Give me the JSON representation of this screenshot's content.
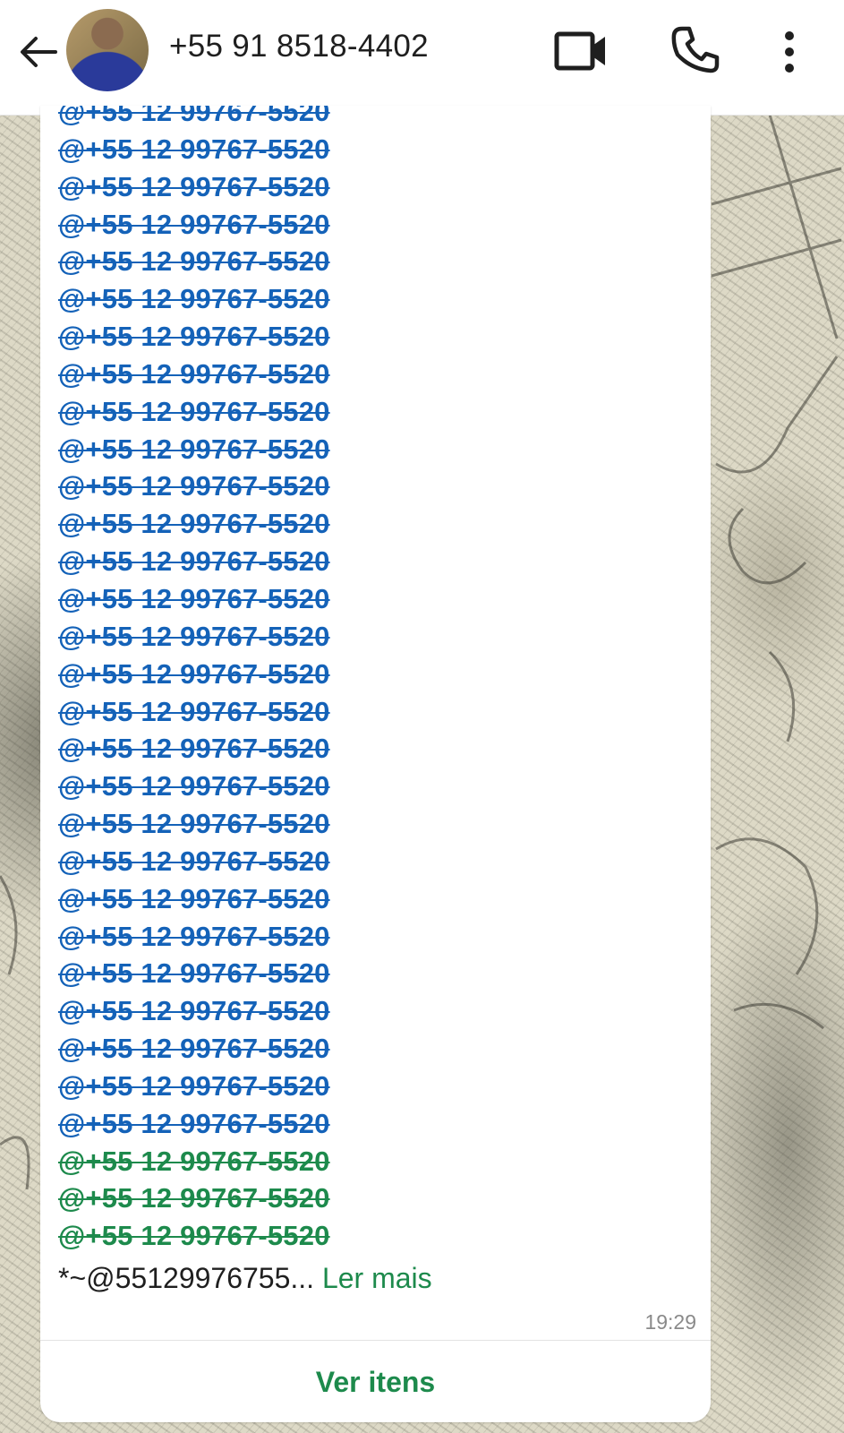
{
  "header": {
    "contact_name": "+55 91 8518-4402",
    "back_icon": "arrow-left-icon",
    "video_icon": "video-camera-icon",
    "call_icon": "phone-icon",
    "more_icon": "more-vertical-icon"
  },
  "message": {
    "mentions": [
      {
        "text": "@+55 12 99767-5520",
        "color": "blue"
      },
      {
        "text": "@+55 12 99767-5520",
        "color": "blue"
      },
      {
        "text": "@+55 12 99767-5520",
        "color": "blue"
      },
      {
        "text": "@+55 12 99767-5520",
        "color": "blue"
      },
      {
        "text": "@+55 12 99767-5520",
        "color": "blue"
      },
      {
        "text": "@+55 12 99767-5520",
        "color": "blue"
      },
      {
        "text": "@+55 12 99767-5520",
        "color": "blue"
      },
      {
        "text": "@+55 12 99767-5520",
        "color": "blue"
      },
      {
        "text": "@+55 12 99767-5520",
        "color": "blue"
      },
      {
        "text": "@+55 12 99767-5520",
        "color": "blue"
      },
      {
        "text": "@+55 12 99767-5520",
        "color": "blue"
      },
      {
        "text": "@+55 12 99767-5520",
        "color": "blue"
      },
      {
        "text": "@+55 12 99767-5520",
        "color": "blue"
      },
      {
        "text": "@+55 12 99767-5520",
        "color": "blue"
      },
      {
        "text": "@+55 12 99767-5520",
        "color": "blue"
      },
      {
        "text": "@+55 12 99767-5520",
        "color": "blue"
      },
      {
        "text": "@+55 12 99767-5520",
        "color": "blue"
      },
      {
        "text": "@+55 12 99767-5520",
        "color": "blue"
      },
      {
        "text": "@+55 12 99767-5520",
        "color": "blue"
      },
      {
        "text": "@+55 12 99767-5520",
        "color": "blue"
      },
      {
        "text": "@+55 12 99767-5520",
        "color": "blue"
      },
      {
        "text": "@+55 12 99767-5520",
        "color": "blue"
      },
      {
        "text": "@+55 12 99767-5520",
        "color": "blue"
      },
      {
        "text": "@+55 12 99767-5520",
        "color": "blue"
      },
      {
        "text": "@+55 12 99767-5520",
        "color": "blue"
      },
      {
        "text": "@+55 12 99767-5520",
        "color": "blue"
      },
      {
        "text": "@+55 12 99767-5520",
        "color": "blue"
      },
      {
        "text": "@+55 12 99767-5520",
        "color": "blue"
      },
      {
        "text": "@+55 12 99767-5520",
        "color": "green"
      },
      {
        "text": "@+55 12 99767-5520",
        "color": "green"
      },
      {
        "text": "@+55 12 99767-5520",
        "color": "green"
      }
    ],
    "preview_text": "*~@55129976755...",
    "read_more_label": "Ler mais",
    "timestamp": "19:29",
    "view_items_label": "Ver itens"
  },
  "colors": {
    "mention_blue": "#1462b8",
    "mention_green": "#1d8a4c",
    "accent_green": "#1d8a4c"
  }
}
